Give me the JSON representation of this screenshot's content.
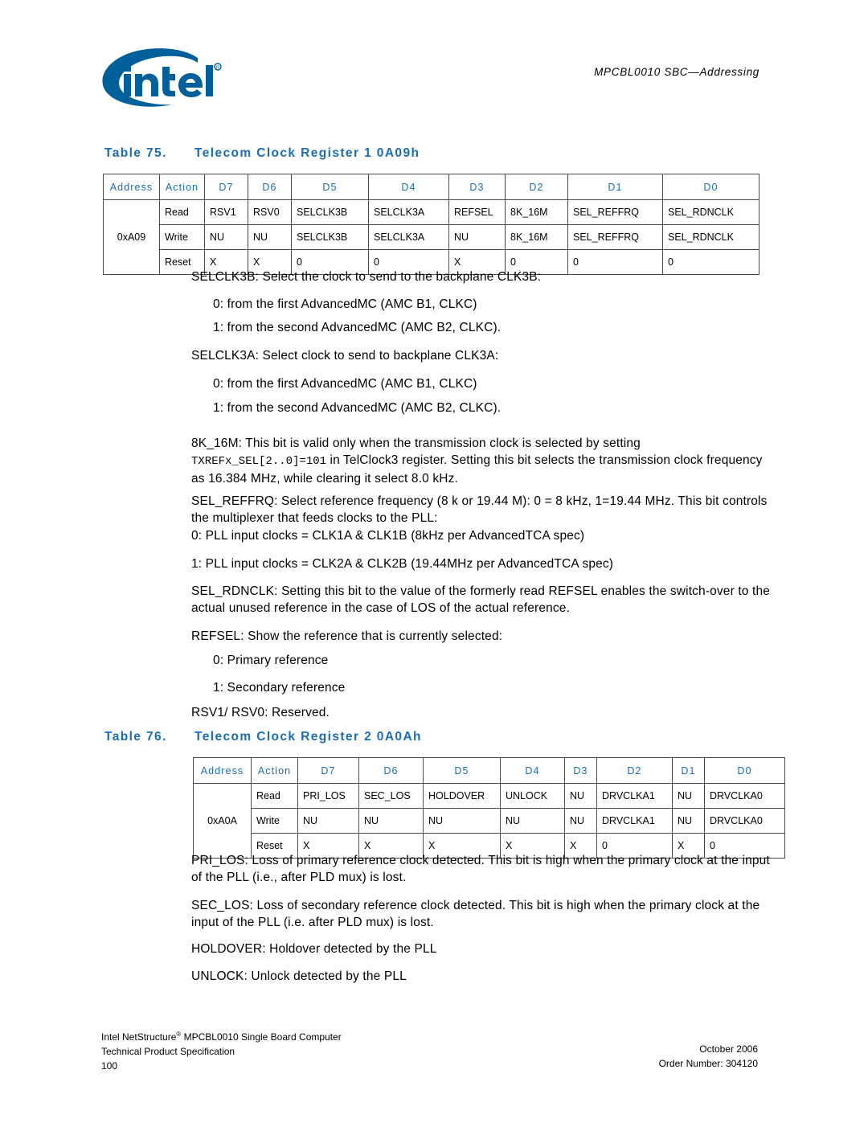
{
  "header": {
    "logo_alt": "intel",
    "doc_title": "MPCBL0010 SBC—Addressing"
  },
  "colors": {
    "accent_blue": "#1a6cb5",
    "logo_blue": "#00609c",
    "table_border": "#4a4a4a",
    "text": "#000000"
  },
  "table75": {
    "caption_number": "Table 75.",
    "caption_title": "Telecom Clock Register 1 0A09h",
    "columns": [
      "Address",
      "Action",
      "D7",
      "D6",
      "D5",
      "D4",
      "D3",
      "D2",
      "D1",
      "D0"
    ],
    "address": "0xA09",
    "rows": [
      {
        "action": "Read",
        "d7": "RSV1",
        "d6": "RSV0",
        "d5": "SELCLK3B",
        "d4": "SELCLK3A",
        "d3": "REFSEL",
        "d2": "8K_16M",
        "d1": "SEL_REFFRQ",
        "d0": "SEL_RDNCLK"
      },
      {
        "action": "Write",
        "d7": "NU",
        "d6": "NU",
        "d5": "SELCLK3B",
        "d4": "SELCLK3A",
        "d3": "NU",
        "d2": "8K_16M",
        "d1": "SEL_REFFRQ",
        "d0": "SEL_RDNCLK"
      },
      {
        "action": "Reset",
        "d7": "X",
        "d6": "X",
        "d5": "0",
        "d4": "0",
        "d3": "X",
        "d2": "0",
        "d1": "0",
        "d0": "0"
      }
    ]
  },
  "table76": {
    "caption_number": "Table 76.",
    "caption_title": "Telecom Clock Register 2 0A0Ah",
    "columns": [
      "Address",
      "Action",
      "D7",
      "D6",
      "D5",
      "D4",
      "D3",
      "D2",
      "D1",
      "D0"
    ],
    "address": "0xA0A",
    "rows": [
      {
        "action": "Read",
        "d7": "PRI_LOS",
        "d6": "SEC_LOS",
        "d5": "HOLDOVER",
        "d4": "UNLOCK",
        "d3": "NU",
        "d2": "DRVCLKA1",
        "d1": "NU",
        "d0": "DRVCLKA0"
      },
      {
        "action": "Write",
        "d7": "NU",
        "d6": "NU",
        "d5": "NU",
        "d4": "NU",
        "d3": "NU",
        "d2": "DRVCLKA1",
        "d1": "NU",
        "d0": "DRVCLKA0"
      },
      {
        "action": "Reset",
        "d7": "X",
        "d6": "X",
        "d5": "X",
        "d4": "X",
        "d3": "X",
        "d2": "0",
        "d1": "X",
        "d0": "0"
      }
    ]
  },
  "body": {
    "p1": "SELCLK3B: Select the clock to send to the backplane CLK3B:",
    "p2": "0: from the first AdvancedMC (AMC B1, CLKC)",
    "p3": "1: from the second AdvancedMC (AMC B2, CLKC).",
    "p4": "SELCLK3A: Select clock to send to backplane CLK3A:",
    "p5": "0: from the first AdvancedMC (AMC B1, CLKC)",
    "p6": "1: from the second AdvancedMC (AMC B2, CLKC).",
    "p7_a": "8K_16M: This bit is valid only when the transmission clock is selected by setting ",
    "p7_code": "TXREFx_SEL[2..0]=101",
    "p7_b": " in TelClock3 register. Setting this bit selects the transmission clock frequency as 16.384 MHz, while clearing it select 8.0 kHz.",
    "p8": "SEL_REFFRQ: Select reference frequency (8 k or 19.44 M): 0 = 8 kHz, 1=19.44 MHz. This bit controls the multiplexer that feeds clocks to the PLL:",
    "p9": "0: PLL input clocks = CLK1A & CLK1B (8kHz per AdvancedTCA spec)",
    "p10": "1: PLL input clocks = CLK2A & CLK2B (19.44MHz per AdvancedTCA spec)",
    "p11": "SEL_RDNCLK: Setting this bit to the value of the formerly read REFSEL enables the switch-over to the actual unused reference in the case of LOS of the actual reference.",
    "p12": "REFSEL: Show the reference that is currently selected:",
    "p13": "0: Primary reference",
    "p14": "1: Secondary reference",
    "p15": "RSV1/ RSV0: Reserved.",
    "p16": "PRI_LOS: Loss of primary reference clock detected. This bit is high when the primary clock at the input of the PLL (i.e., after PLD mux) is lost.",
    "p17": "SEC_LOS: Loss of secondary reference clock detected. This bit is high when the primary clock at the input of the PLL (i.e. after PLD mux) is lost.",
    "p18": "HOLDOVER: Holdover detected by the PLL",
    "p19": "UNLOCK: Unlock detected by the PLL"
  },
  "footer": {
    "line1_a": "Intel NetStructure",
    "line1_mark": "®",
    "line1_b": " MPCBL0010 Single Board Computer",
    "line2": "Technical Product Specification",
    "page_number": "100",
    "date": "October 2006",
    "order_number": "Order Number: 304120"
  }
}
